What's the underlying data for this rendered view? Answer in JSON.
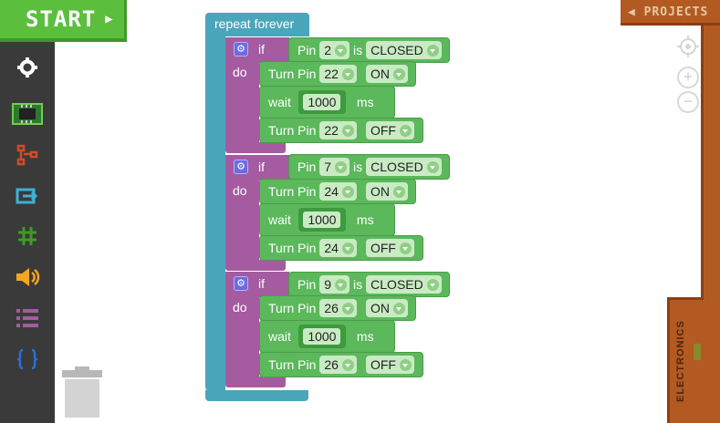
{
  "toolbar": {
    "start_label": "START"
  },
  "sidebar": {
    "categories": [
      {
        "name": "settings",
        "color": "#ffffff"
      },
      {
        "name": "board",
        "color": "#5bbf3d"
      },
      {
        "name": "logic",
        "color": "#d34b2a"
      },
      {
        "name": "loops",
        "color": "#3bb3d6"
      },
      {
        "name": "math",
        "color": "#5bbf3d"
      },
      {
        "name": "sound",
        "color": "#f4a620"
      },
      {
        "name": "lists",
        "color": "#a55ba0"
      },
      {
        "name": "functions",
        "color": "#2b6fd6"
      }
    ]
  },
  "right_panel": {
    "projects_label": "PROJECTS",
    "electronics_label": "ELECTRONICS"
  },
  "program": {
    "loop_label": "repeat forever",
    "blocks": [
      {
        "if_label": "if",
        "do_label": "do",
        "cond": {
          "pin_label": "Pin",
          "pin": "2",
          "is_label": "is",
          "state": "CLOSED"
        },
        "turn_on": {
          "label": "Turn Pin",
          "pin": "22",
          "state": "ON"
        },
        "wait": {
          "label": "wait",
          "ms": "1000",
          "unit": "ms"
        },
        "turn_off": {
          "label": "Turn Pin",
          "pin": "22",
          "state": "OFF"
        }
      },
      {
        "if_label": "if",
        "do_label": "do",
        "cond": {
          "pin_label": "Pin",
          "pin": "7",
          "is_label": "is",
          "state": "CLOSED"
        },
        "turn_on": {
          "label": "Turn Pin",
          "pin": "24",
          "state": "ON"
        },
        "wait": {
          "label": "wait",
          "ms": "1000",
          "unit": "ms"
        },
        "turn_off": {
          "label": "Turn Pin",
          "pin": "24",
          "state": "OFF"
        }
      },
      {
        "if_label": "if",
        "do_label": "do",
        "cond": {
          "pin_label": "Pin",
          "pin": "9",
          "is_label": "is",
          "state": "CLOSED"
        },
        "turn_on": {
          "label": "Turn Pin",
          "pin": "26",
          "state": "ON"
        },
        "wait": {
          "label": "wait",
          "ms": "1000",
          "unit": "ms"
        },
        "turn_off": {
          "label": "Turn Pin",
          "pin": "26",
          "state": "OFF"
        }
      }
    ]
  }
}
